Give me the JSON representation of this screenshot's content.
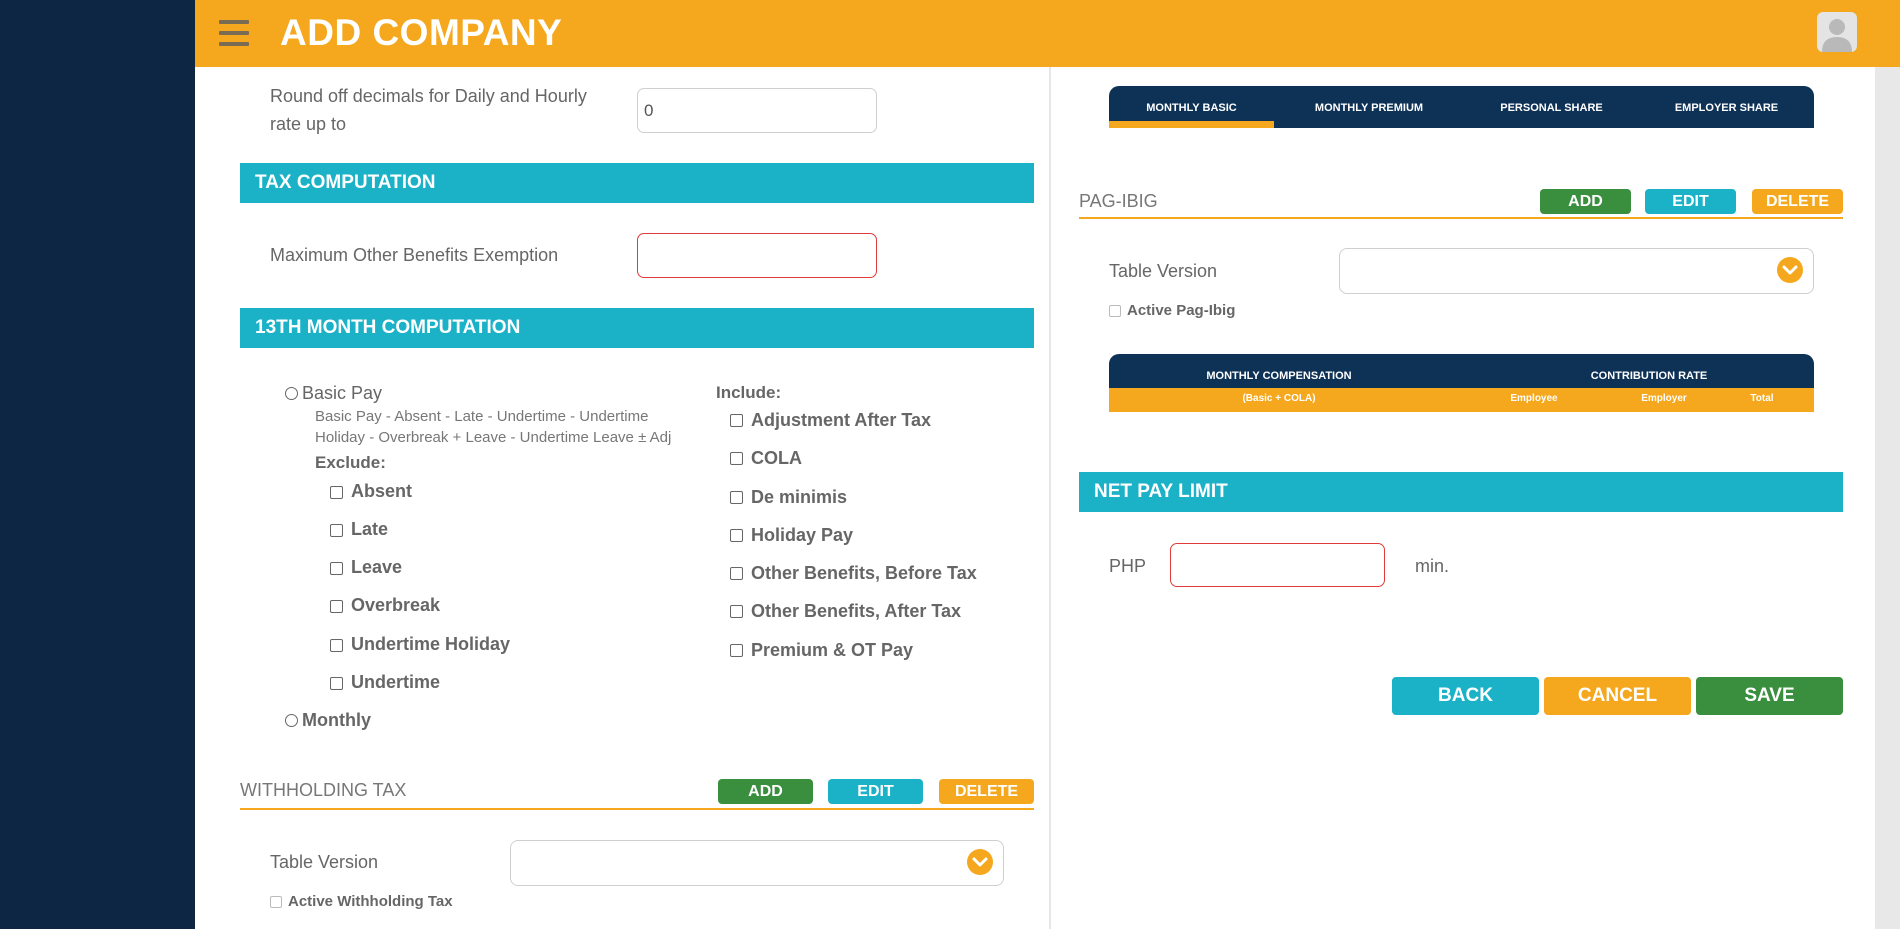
{
  "header": {
    "title": "ADD COMPANY"
  },
  "rounding": {
    "label_line1": "Round off decimals for Daily and Hourly",
    "label_line2": "rate up to",
    "value": "0"
  },
  "tax": {
    "section_title": "TAX COMPUTATION",
    "max_exemption_label": "Maximum Other Benefits Exemption",
    "max_exemption_value": ""
  },
  "thirteenth": {
    "section_title": "13TH MONTH COMPUTATION",
    "basic_pay_label": "Basic Pay",
    "formula_line1": "Basic Pay - Absent - Late - Undertime - Undertime",
    "formula_line2": "Holiday - Overbreak + Leave - Undertime Leave ± Adj",
    "exclude_label": "Exclude:",
    "exclude": [
      "Absent",
      "Late",
      "Leave",
      "Overbreak",
      "Undertime Holiday",
      "Undertime"
    ],
    "monthly_label": "Monthly",
    "include_label": "Include:",
    "include": [
      "Adjustment After Tax",
      "COLA",
      "De minimis",
      "Holiday Pay",
      "Other Benefits, Before Tax",
      "Other Benefits, After Tax",
      "Premium & OT Pay"
    ]
  },
  "withholding": {
    "title": "WITHHOLDING TAX",
    "add": "ADD",
    "edit": "EDIT",
    "delete": "DELETE",
    "table_version_label": "Table Version",
    "active_label": "Active Withholding Tax"
  },
  "contrib_tabs": [
    "MONTHLY BASIC",
    "MONTHLY PREMIUM",
    "PERSONAL SHARE",
    "EMPLOYER SHARE"
  ],
  "pagibig": {
    "title": "PAG-IBIG",
    "add": "ADD",
    "edit": "EDIT",
    "delete": "DELETE",
    "table_version_label": "Table Version",
    "active_label": "Active Pag-Ibig",
    "table": {
      "col1": "MONTHLY COMPENSATION",
      "col2": "CONTRIBUTION RATE",
      "sub1": "(Basic + COLA)",
      "sub_employee": "Employee",
      "sub_employer": "Employer",
      "sub_total": "Total"
    }
  },
  "netpay": {
    "section_title": "NET PAY LIMIT",
    "currency": "PHP",
    "value": "",
    "suffix": "min."
  },
  "actions": {
    "back": "BACK",
    "cancel": "CANCEL",
    "save": "SAVE"
  },
  "colors": {
    "accent": "#f5a81d",
    "teal": "#1bb2c8",
    "green": "#3a8f3f",
    "navy": "#0c2644"
  }
}
